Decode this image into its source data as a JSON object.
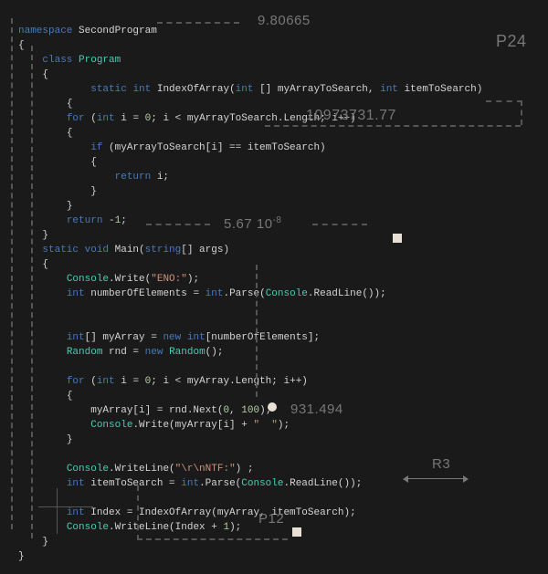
{
  "lines": [
    [
      [
        "kw-ns",
        "namespace"
      ],
      [
        "ident",
        " SecondProgram"
      ]
    ],
    [
      [
        "brace",
        "{"
      ]
    ],
    [
      [
        "ident",
        "    "
      ],
      [
        "kw-class",
        "class"
      ],
      [
        "ident",
        " "
      ],
      [
        "name-prog",
        "Program"
      ]
    ],
    [
      [
        "ident",
        "    "
      ],
      [
        "brace",
        "{"
      ]
    ],
    [
      [
        "ident",
        "            "
      ],
      [
        "kw-static",
        "static"
      ],
      [
        "ident",
        " "
      ],
      [
        "kw-int",
        "int"
      ],
      [
        "ident",
        " IndexOfArray("
      ],
      [
        "kw-int",
        "int"
      ],
      [
        "ident",
        " [] myArrayToSearch, "
      ],
      [
        "kw-int",
        "int"
      ],
      [
        "ident",
        " itemToSearch)"
      ]
    ],
    [
      [
        "ident",
        "        "
      ],
      [
        "brace",
        "{"
      ]
    ],
    [
      [
        "ident",
        "        "
      ],
      [
        "kw-for",
        "for"
      ],
      [
        "ident",
        " ("
      ],
      [
        "kw-int",
        "int"
      ],
      [
        "ident",
        " i = "
      ],
      [
        "num",
        "0"
      ],
      [
        "ident",
        "; i < myArrayToSearch.Length; i++)"
      ]
    ],
    [
      [
        "ident",
        "        "
      ],
      [
        "brace",
        "{"
      ]
    ],
    [
      [
        "ident",
        "            "
      ],
      [
        "kw-if",
        "if"
      ],
      [
        "ident",
        " (myArrayToSearch[i] == itemToSearch)"
      ]
    ],
    [
      [
        "ident",
        "            "
      ],
      [
        "brace",
        "{"
      ]
    ],
    [
      [
        "ident",
        "                "
      ],
      [
        "kw-ret",
        "return"
      ],
      [
        "ident",
        " i;"
      ]
    ],
    [
      [
        "ident",
        "            "
      ],
      [
        "brace",
        "}"
      ]
    ],
    [
      [
        "ident",
        "        "
      ],
      [
        "brace",
        "}"
      ]
    ],
    [
      [
        "ident",
        "        "
      ],
      [
        "kw-ret",
        "return"
      ],
      [
        "ident",
        " -"
      ],
      [
        "num",
        "1"
      ],
      [
        "ident",
        ";"
      ]
    ],
    [
      [
        "ident",
        "    "
      ],
      [
        "brace",
        "}"
      ]
    ],
    [
      [
        "ident",
        "    "
      ],
      [
        "kw-static",
        "static"
      ],
      [
        "ident",
        " "
      ],
      [
        "kw-void",
        "void"
      ],
      [
        "ident",
        " Main("
      ],
      [
        "kw-string",
        "string"
      ],
      [
        "ident",
        "[] args)"
      ]
    ],
    [
      [
        "ident",
        "    "
      ],
      [
        "brace",
        "{"
      ]
    ],
    [
      [
        "ident",
        "        "
      ],
      [
        "type-name",
        "Console"
      ],
      [
        "ident",
        ".Write("
      ],
      [
        "str",
        "\"ENO:\""
      ],
      [
        "ident",
        ");"
      ]
    ],
    [
      [
        "ident",
        "        "
      ],
      [
        "kw-int",
        "int"
      ],
      [
        "ident",
        " numberOfElements = "
      ],
      [
        "kw-int",
        "int"
      ],
      [
        "ident",
        ".Parse("
      ],
      [
        "type-name",
        "Console"
      ],
      [
        "ident",
        ".ReadLine());"
      ]
    ],
    [
      [
        "ident",
        " "
      ]
    ],
    [
      [
        "ident",
        " "
      ]
    ],
    [
      [
        "ident",
        "        "
      ],
      [
        "kw-int",
        "int"
      ],
      [
        "ident",
        "[] myArray = "
      ],
      [
        "kw-new",
        "new"
      ],
      [
        "ident",
        " "
      ],
      [
        "kw-int",
        "int"
      ],
      [
        "ident",
        "[numberOfElements];"
      ]
    ],
    [
      [
        "ident",
        "        "
      ],
      [
        "type-name",
        "Random"
      ],
      [
        "ident",
        " rnd = "
      ],
      [
        "kw-new",
        "new"
      ],
      [
        "ident",
        " "
      ],
      [
        "type-name",
        "Random"
      ],
      [
        "ident",
        "();"
      ]
    ],
    [
      [
        "ident",
        " "
      ]
    ],
    [
      [
        "ident",
        "        "
      ],
      [
        "kw-for",
        "for"
      ],
      [
        "ident",
        " ("
      ],
      [
        "kw-int",
        "int"
      ],
      [
        "ident",
        " i = "
      ],
      [
        "num",
        "0"
      ],
      [
        "ident",
        "; i < myArray.Length; i++)"
      ]
    ],
    [
      [
        "ident",
        "        "
      ],
      [
        "brace",
        "{"
      ]
    ],
    [
      [
        "ident",
        "            myArray[i] = rnd.Next("
      ],
      [
        "num",
        "0"
      ],
      [
        "ident",
        ", "
      ],
      [
        "num",
        "100"
      ],
      [
        "ident",
        ");"
      ]
    ],
    [
      [
        "ident",
        "            "
      ],
      [
        "type-name",
        "Console"
      ],
      [
        "ident",
        ".Write(myArray[i] + "
      ],
      [
        "str",
        "\"  \""
      ],
      [
        "ident",
        ");"
      ]
    ],
    [
      [
        "ident",
        "        "
      ],
      [
        "brace",
        "}"
      ]
    ],
    [
      [
        "ident",
        " "
      ]
    ],
    [
      [
        "ident",
        "        "
      ],
      [
        "type-name",
        "Console"
      ],
      [
        "ident",
        ".WriteLine("
      ],
      [
        "str",
        "\"\\r\\nNTF:\""
      ],
      [
        "ident",
        ") ;"
      ]
    ],
    [
      [
        "ident",
        "        "
      ],
      [
        "kw-int",
        "int"
      ],
      [
        "ident",
        " itemToSearch = "
      ],
      [
        "kw-int",
        "int"
      ],
      [
        "ident",
        ".Parse("
      ],
      [
        "type-name",
        "Console"
      ],
      [
        "ident",
        ".ReadLine());"
      ]
    ],
    [
      [
        "ident",
        " "
      ]
    ],
    [
      [
        "ident",
        "        "
      ],
      [
        "kw-int",
        "int"
      ],
      [
        "ident",
        " Index = IndexOfArray(myArray, itemToSearch);"
      ]
    ],
    [
      [
        "ident",
        "        "
      ],
      [
        "type-name",
        "Console"
      ],
      [
        "ident",
        ".WriteLine(Index + "
      ],
      [
        "num",
        "1"
      ],
      [
        "ident",
        ");"
      ]
    ],
    [
      [
        "ident",
        "    "
      ],
      [
        "brace",
        "}"
      ]
    ],
    [
      [
        "brace",
        "}"
      ]
    ]
  ],
  "annotations": {
    "a1": "9.80665",
    "a2": "P24",
    "a3": "10973731.77",
    "a4": "5.67 10",
    "a4sup": "-8",
    "a5": "931.494",
    "a6": "R3",
    "a7": "P12"
  }
}
